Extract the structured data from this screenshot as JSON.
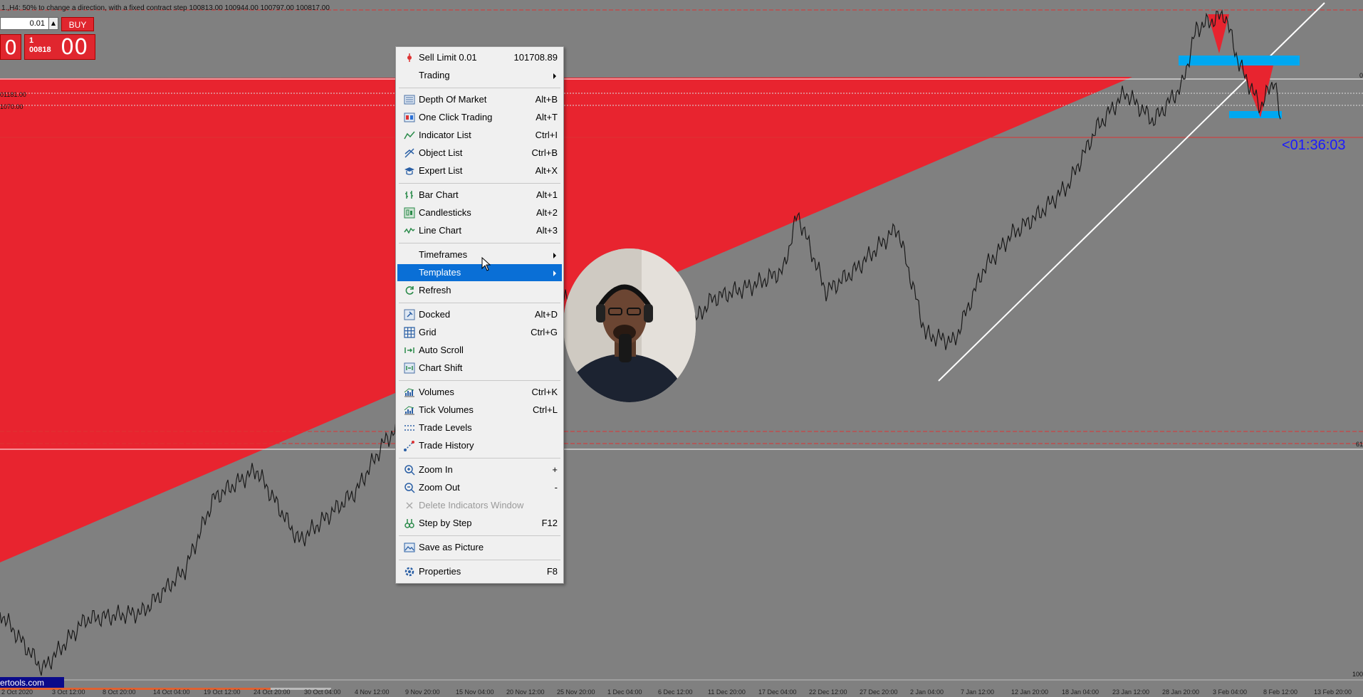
{
  "chart": {
    "top_info": "1.,H4: 50% to change a direction, with a fixed contract step  100813.00 100944.00 100797.00 100817.00",
    "lot_value": "0.01",
    "buy_label": "BUY",
    "sell_price_big": "0",
    "buy_price_small_1": "1",
    "buy_price_small_2": "00818",
    "buy_price_big": "00",
    "price_label_1": "01181.00",
    "price_label_2": "1070.00",
    "timer": "<01:36:03",
    "brand": "ertools.com",
    "right_ticks": [
      "0",
      "61",
      "100"
    ],
    "xaxis_dates": [
      "2 Oct 2020",
      "3 Oct 12:00",
      "8 Oct 20:00",
      "14 Oct 04:00",
      "19 Oct 12:00",
      "24 Oct 20:00",
      "30 Oct 04:00",
      "4 Nov 12:00",
      "9 Nov 20:00",
      "15 Nov 04:00",
      "20 Nov 12:00",
      "25 Nov 20:00",
      "1 Dec 04:00",
      "6 Dec 12:00",
      "11 Dec 20:00",
      "17 Dec 04:00",
      "22 Dec 12:00",
      "27 Dec 20:00",
      "2 Jan 04:00",
      "7 Jan 12:00",
      "12 Jan 20:00",
      "18 Jan 04:00",
      "23 Jan 12:00",
      "28 Jan 20:00",
      "3 Feb 04:00",
      "8 Feb 12:00",
      "13 Feb 20:00"
    ],
    "colors": {
      "background": "#808080",
      "triangle": "#e8242f",
      "zone": "#00a8f0",
      "timer": "#1a1aff"
    }
  },
  "context_menu": {
    "items": [
      {
        "name": "sell-limit",
        "label": "Sell Limit 0.01",
        "shortcut": "101708.89",
        "icon": "sell-limit-icon"
      },
      {
        "name": "trading",
        "label": "Trading",
        "submenu": true
      },
      {
        "name": "depth-of-market",
        "label": "Depth Of Market",
        "shortcut": "Alt+B",
        "icon": "depth-of-market-icon"
      },
      {
        "name": "one-click-trading",
        "label": "One Click Trading",
        "shortcut": "Alt+T",
        "icon": "one-click-trading-icon"
      },
      {
        "name": "indicator-list",
        "label": "Indicator List",
        "shortcut": "Ctrl+I",
        "icon": "indicator-list-icon"
      },
      {
        "name": "object-list",
        "label": "Object List",
        "shortcut": "Ctrl+B",
        "icon": "object-list-icon"
      },
      {
        "name": "expert-list",
        "label": "Expert List",
        "shortcut": "Alt+X",
        "icon": "expert-list-icon"
      },
      {
        "name": "bar-chart",
        "label": "Bar Chart",
        "shortcut": "Alt+1",
        "icon": "bar-chart-icon"
      },
      {
        "name": "candlesticks",
        "label": "Candlesticks",
        "shortcut": "Alt+2",
        "icon": "candlesticks-icon"
      },
      {
        "name": "line-chart",
        "label": "Line Chart",
        "shortcut": "Alt+3",
        "icon": "line-chart-icon"
      },
      {
        "name": "timeframes",
        "label": "Timeframes",
        "submenu": true
      },
      {
        "name": "templates",
        "label": "Templates",
        "submenu": true,
        "active": true
      },
      {
        "name": "refresh",
        "label": "Refresh",
        "icon": "refresh-icon"
      },
      {
        "name": "docked",
        "label": "Docked",
        "shortcut": "Alt+D",
        "icon": "docked-icon"
      },
      {
        "name": "grid",
        "label": "Grid",
        "shortcut": "Ctrl+G",
        "icon": "grid-icon"
      },
      {
        "name": "auto-scroll",
        "label": "Auto Scroll",
        "icon": "auto-scroll-icon"
      },
      {
        "name": "chart-shift",
        "label": "Chart Shift",
        "icon": "chart-shift-icon"
      },
      {
        "name": "volumes",
        "label": "Volumes",
        "shortcut": "Ctrl+K",
        "icon": "volumes-icon"
      },
      {
        "name": "tick-volumes",
        "label": "Tick Volumes",
        "shortcut": "Ctrl+L",
        "icon": "tick-volumes-icon"
      },
      {
        "name": "trade-levels",
        "label": "Trade Levels",
        "icon": "trade-levels-icon"
      },
      {
        "name": "trade-history",
        "label": "Trade History",
        "icon": "trade-history-icon"
      },
      {
        "name": "zoom-in",
        "label": "Zoom In",
        "shortcut": "+",
        "icon": "zoom-in-icon"
      },
      {
        "name": "zoom-out",
        "label": "Zoom Out",
        "shortcut": "-",
        "icon": "zoom-out-icon"
      },
      {
        "name": "delete-indicators-window",
        "label": "Delete Indicators Window",
        "disabled": true,
        "icon": "delete-icon"
      },
      {
        "name": "step-by-step",
        "label": "Step by Step",
        "shortcut": "F12",
        "icon": "step-by-step-icon"
      },
      {
        "name": "save-as-picture",
        "label": "Save as Picture",
        "icon": "save-as-picture-icon"
      },
      {
        "name": "properties",
        "label": "Properties",
        "shortcut": "F8",
        "icon": "properties-icon"
      }
    ]
  }
}
